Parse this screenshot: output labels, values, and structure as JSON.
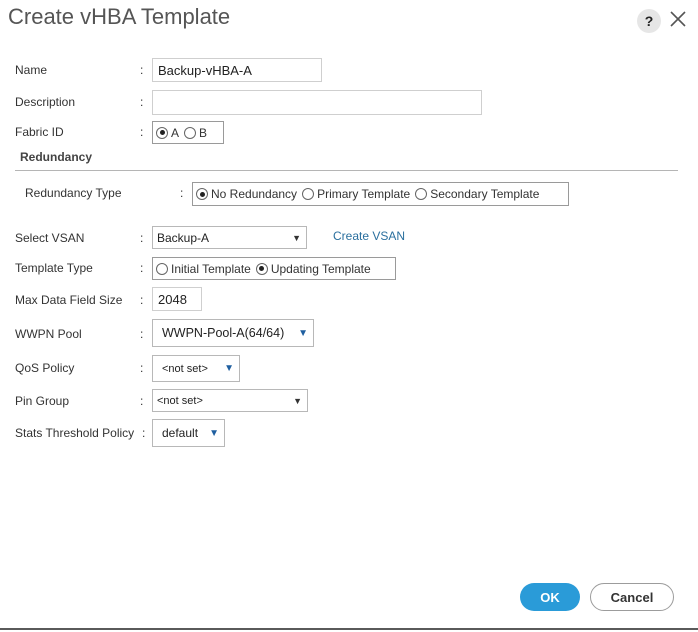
{
  "dialog": {
    "title": "Create vHBA Template",
    "help_label": "?"
  },
  "form": {
    "name": {
      "label": "Name",
      "value": "Backup-vHBA-A"
    },
    "description": {
      "label": "Description",
      "value": ""
    },
    "fabric_id": {
      "label": "Fabric ID",
      "options": [
        "A",
        "B"
      ],
      "selected": "A"
    },
    "redundancy_section": "Redundancy",
    "redundancy_type": {
      "label": "Redundancy Type",
      "options": [
        "No Redundancy",
        "Primary Template",
        "Secondary Template"
      ],
      "selected": "No Redundancy"
    },
    "select_vsan": {
      "label": "Select VSAN",
      "value": "Backup-A",
      "link": "Create VSAN"
    },
    "template_type": {
      "label": "Template Type",
      "options": [
        "Initial Template",
        "Updating Template"
      ],
      "selected": "Updating Template"
    },
    "max_data_field_size": {
      "label": "Max Data Field Size",
      "value": "2048"
    },
    "wwpn_pool": {
      "label": "WWPN Pool",
      "value": "WWPN-Pool-A(64/64)"
    },
    "qos_policy": {
      "label": "QoS Policy",
      "value": "<not set>"
    },
    "pin_group": {
      "label": "Pin Group",
      "value": "<not set>"
    },
    "stats_threshold_policy": {
      "label": "Stats Threshold Policy",
      "value": "default"
    },
    "colon": ":"
  },
  "buttons": {
    "ok": "OK",
    "cancel": "Cancel"
  },
  "colors": {
    "primary": "#2a9bd8",
    "link": "#2a6f9e",
    "dropdown_arrow": "#1f5fa0"
  }
}
